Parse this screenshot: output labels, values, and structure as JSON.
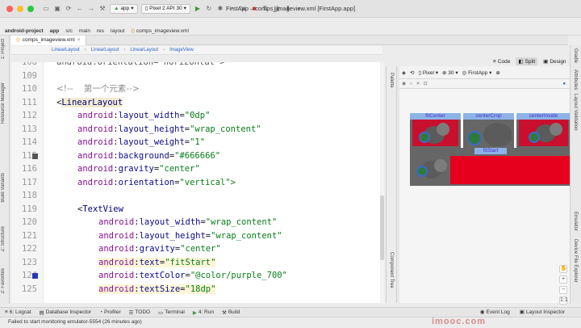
{
  "window": {
    "title": "FirstApp – comps_imageview.xml [FirstApp.app]",
    "run_config": "app",
    "device": "Pixel 2 API 30"
  },
  "breadcrumb": [
    "android-project",
    "app",
    "src",
    "main",
    "res",
    "layout",
    "comps_imageview.xml"
  ],
  "file_tab": "comps_imageview.xml",
  "editor_crumbs": [
    "LinearLayout",
    "LinearLayout",
    "LinearLayout",
    "ImageView"
  ],
  "view_modes": [
    "Code",
    "Split",
    "Design"
  ],
  "active_view_mode": "Split",
  "left_tools": [
    "1: Project",
    "Resource Manager",
    "Build Variants",
    "Z: Structure",
    "2: Favorites"
  ],
  "right_tools": [
    "Gradle",
    "Attributes",
    "Layout Validation",
    "Emulator",
    "Device File Explorer"
  ],
  "design_toolbar": {
    "device": "Pixel",
    "api": "30",
    "theme": "FirstApp",
    "palette_label": "Palette",
    "component_tree_label": "Component Tree"
  },
  "code_lines": [
    {
      "num": "108",
      "indent": 0,
      "text": "android:orientation=\"horizontal\">",
      "type": "cut"
    },
    {
      "num": "109",
      "indent": 0,
      "text": "",
      "type": "blank"
    },
    {
      "num": "110",
      "indent": 0,
      "text": "<!--    第一个元素-->",
      "type": "comment"
    },
    {
      "num": "111",
      "indent": 0,
      "tag": "LinearLayout",
      "type": "open-tag"
    },
    {
      "num": "112",
      "indent": 1,
      "ns": "android",
      "attr": "layout_width",
      "val": "\"0dp\"",
      "type": "attr"
    },
    {
      "num": "113",
      "indent": 1,
      "ns": "android",
      "attr": "layout_height",
      "val": "\"wrap_content\"",
      "type": "attr"
    },
    {
      "num": "114",
      "indent": 1,
      "ns": "android",
      "attr": "layout_weight",
      "val": "\"1\"",
      "type": "attr"
    },
    {
      "num": "115",
      "indent": 1,
      "ns": "android",
      "attr": "background",
      "val": "\"#666666\"",
      "type": "attr",
      "marker": "gray"
    },
    {
      "num": "116",
      "indent": 1,
      "ns": "android",
      "attr": "gravity",
      "val": "\"center\"",
      "type": "attr"
    },
    {
      "num": "117",
      "indent": 1,
      "ns": "android",
      "attr": "orientation",
      "val": "\"vertical\">",
      "type": "attr"
    },
    {
      "num": "118",
      "indent": 0,
      "text": "",
      "type": "blank"
    },
    {
      "num": "119",
      "indent": 1,
      "tag": "TextView",
      "type": "open-tag"
    },
    {
      "num": "120",
      "indent": 2,
      "ns": "android",
      "attr": "layout_width",
      "val": "\"wrap_content\"",
      "type": "attr"
    },
    {
      "num": "121",
      "indent": 2,
      "ns": "android",
      "attr": "layout_height",
      "val": "\"wrap_content\"",
      "type": "attr"
    },
    {
      "num": "122",
      "indent": 2,
      "ns": "android",
      "attr": "gravity",
      "val": "\"center\"",
      "type": "attr"
    },
    {
      "num": "123",
      "indent": 2,
      "ns": "android",
      "attr": "text",
      "val": "\"fitStart\"",
      "type": "attr",
      "highlight": true
    },
    {
      "num": "124",
      "indent": 2,
      "ns": "android",
      "attr": "textColor",
      "val": "\"@color/purple_700\"",
      "type": "attr",
      "marker": "blue"
    },
    {
      "num": "125",
      "indent": 2,
      "ns": "android",
      "attr": "textSize",
      "val": "\"18dp\"",
      "type": "attr",
      "highlight": true
    }
  ],
  "preview_labels": [
    "fitCenter",
    "centerCrop",
    "centerInside",
    "fitStart"
  ],
  "bottom_tools": [
    "6: Logcat",
    "Database Inspector",
    "Profiler",
    "TODO",
    "Terminal",
    "4: Run",
    "Build"
  ],
  "bottom_right_tools": [
    "Event Log",
    "Layout Inspector"
  ],
  "status": "Failed to start monitoring emulator-5554 (26 minutes ago)",
  "watermark": "imooc.com",
  "colors": {
    "preview_bg": "#666666",
    "image_red": "#e6001e",
    "label_text": "#4b2ec9",
    "label_bg": "#8db3e6"
  }
}
